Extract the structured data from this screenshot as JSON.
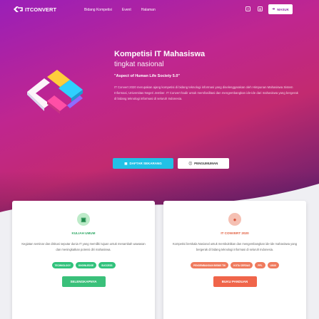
{
  "nav": {
    "logo_text": "ITCONVERT",
    "links": [
      "Bidang Kompetisi",
      "Event",
      "Halaman"
    ],
    "social": [
      {
        "icon": "facebook-icon",
        "glyph": "f"
      },
      {
        "icon": "instagram-icon",
        "glyph": "◎"
      }
    ],
    "login_label": "MASUK",
    "login_icon": "login-icon"
  },
  "hero": {
    "title": "Kompetisi IT Mahasiswa",
    "subtitle": "tingkat nasional",
    "tagline": "\"Aspect of Human Life Society 5.0\"",
    "description": "IT Convert 2020 merupakan ajang kompetisi di bidang teknologi informasi yang diselenggarakan oleh Himpunan Mahasiswa Sistem Informasi, Universitas Negeri Jember. IT Convert hadir untuk memfasilitasi dan mengembangkan ide-ide dari mahasiswa yang bergerak di bidang teknologi informasi di seluruh Indonesia.",
    "register_label": "DAFTAR SEKARANG",
    "register_icon": "calendar-icon",
    "announce_label": "PENGUMUMAN",
    "announce_icon": "info-icon"
  },
  "cards": [
    {
      "icon": "building-icon",
      "glyph": "▣",
      "title": "KULIAH UMUM",
      "description": "Kegiatan seminar dan diskusi seputar dunia IT yang memiliki tujuan untuk menambah wawasan dan meningkatkan potensi diri mahasiswa.",
      "tags": [
        "TECHNOLOGY",
        "KNOWLEDGE",
        "SUCCESS"
      ],
      "button": "SELENGKAPNYA"
    },
    {
      "icon": "trophy-icon",
      "glyph": "●",
      "title": "IT CONVERT 2020",
      "description": "Kompetisi berskala Nasional untuk membuktikan dan mengembangkan ide-ide mahasiswa yang bergerak di bidang teknologi informasi di seluruh Indonesia.",
      "tags": [
        "PENGEMBANGAN BISNIS TIK",
        "KOTA CERDAS",
        "PPL",
        "UI/UX"
      ],
      "button": "BUKU PANDUAN"
    }
  ],
  "colors": {
    "accent_cyan": "#22c1e6",
    "green": "#3ac07a",
    "orange": "#f0654a",
    "purple": "#9a1fb8"
  }
}
